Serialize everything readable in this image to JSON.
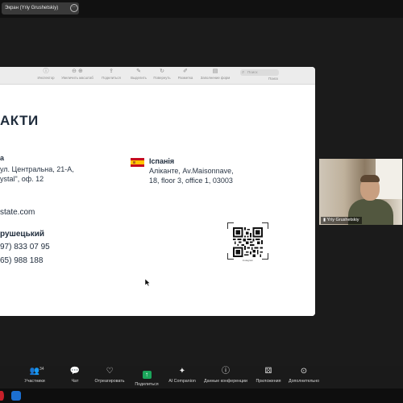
{
  "topbar": {
    "screen_label": "Экран (Yriy Grushetskiy)",
    "more_icon": "more-icon"
  },
  "viewer_toolbar": {
    "items": [
      {
        "label": "Инспектор",
        "icon": "info-icon"
      },
      {
        "label": "Увеличить масштаб",
        "icon": "zoom-icon"
      },
      {
        "label": "Поделиться",
        "icon": "share-icon"
      },
      {
        "label": "Выделить",
        "icon": "highlight-icon"
      },
      {
        "label": "Повернуть",
        "icon": "rotate-icon"
      },
      {
        "label": "Разметка",
        "icon": "markup-icon"
      },
      {
        "label": "Заполнение форм",
        "icon": "form-icon"
      }
    ],
    "search_placeholder": "Поиск",
    "search_label": "Поиск"
  },
  "slide": {
    "title": "АКТИ",
    "office_left": {
      "name": "а",
      "line1": "ул. Центральна, 21-А,",
      "line2": "ystal\", оф. 12"
    },
    "office_right": {
      "name": "Іспанія",
      "line1": "Аліканте, Av.Maisonnave,",
      "line2": "18, floor 3, office 1, 03003"
    },
    "website": "state.com",
    "contact_name": "рушецький",
    "phone1": "97) 833 07 95",
    "phone2": "65) 988 188",
    "qr_caption": "Instagram"
  },
  "video": {
    "participant_name": "Yriy Grushetskiy"
  },
  "bottom_toolbar": {
    "participants_count": "34",
    "items": [
      {
        "label": "Участники",
        "icon": "participants-icon"
      },
      {
        "label": "Чат",
        "icon": "chat-icon"
      },
      {
        "label": "Отреагировать",
        "icon": "heart-icon"
      },
      {
        "label": "Поделиться",
        "icon": "share-screen-icon"
      },
      {
        "label": "AI Companion",
        "icon": "ai-companion-icon"
      },
      {
        "label": "Данные конференции",
        "icon": "info-icon"
      },
      {
        "label": "Приложения",
        "icon": "apps-icon"
      },
      {
        "label": "Дополнительно",
        "icon": "more-icon"
      }
    ]
  },
  "colors": {
    "share_green": "#1aa55a",
    "slide_text": "#1e2b3b",
    "flag_red": "#c60b1e",
    "flag_yellow": "#ffc400"
  }
}
